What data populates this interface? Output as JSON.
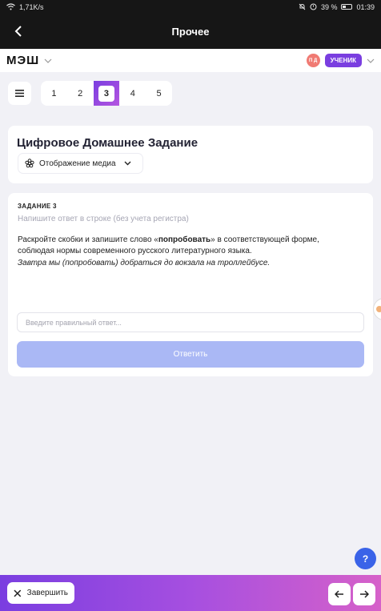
{
  "statusbar": {
    "network": "1,71K/s",
    "battery": "39 %",
    "time": "01:39"
  },
  "titlebar": {
    "title": "Прочее"
  },
  "appbar": {
    "logo": "МЭШ",
    "avatar_initials": "П Д",
    "role": "УЧЕНИК"
  },
  "pager": {
    "pages": [
      "1",
      "2",
      "3",
      "4",
      "5"
    ],
    "active": "3"
  },
  "header_card": {
    "title": "Цифровое Домашнее Задание",
    "media_button": "Отображение медиа"
  },
  "task": {
    "label": "ЗАДАНИЕ 3",
    "hint": "Напишите ответ в строке (без учета регистра)",
    "text_before": "Раскройте скобки и запишите слово «",
    "text_bold": "попробовать",
    "text_after": "» в соответствующей форме, соблюдая нормы современного русского литературного языка.",
    "sentence": "Завтра мы (попробовать) добраться до вокзала на троллейбусе.",
    "input_placeholder": "Введите правильный ответ...",
    "input_value": "",
    "submit_label": "Ответить"
  },
  "help": {
    "label": "?"
  },
  "footer": {
    "finish_label": "Завершить"
  },
  "colors": {
    "accent": "#7a3ee0",
    "submit_disabled": "#aab8f5",
    "help": "#3a63e8"
  }
}
